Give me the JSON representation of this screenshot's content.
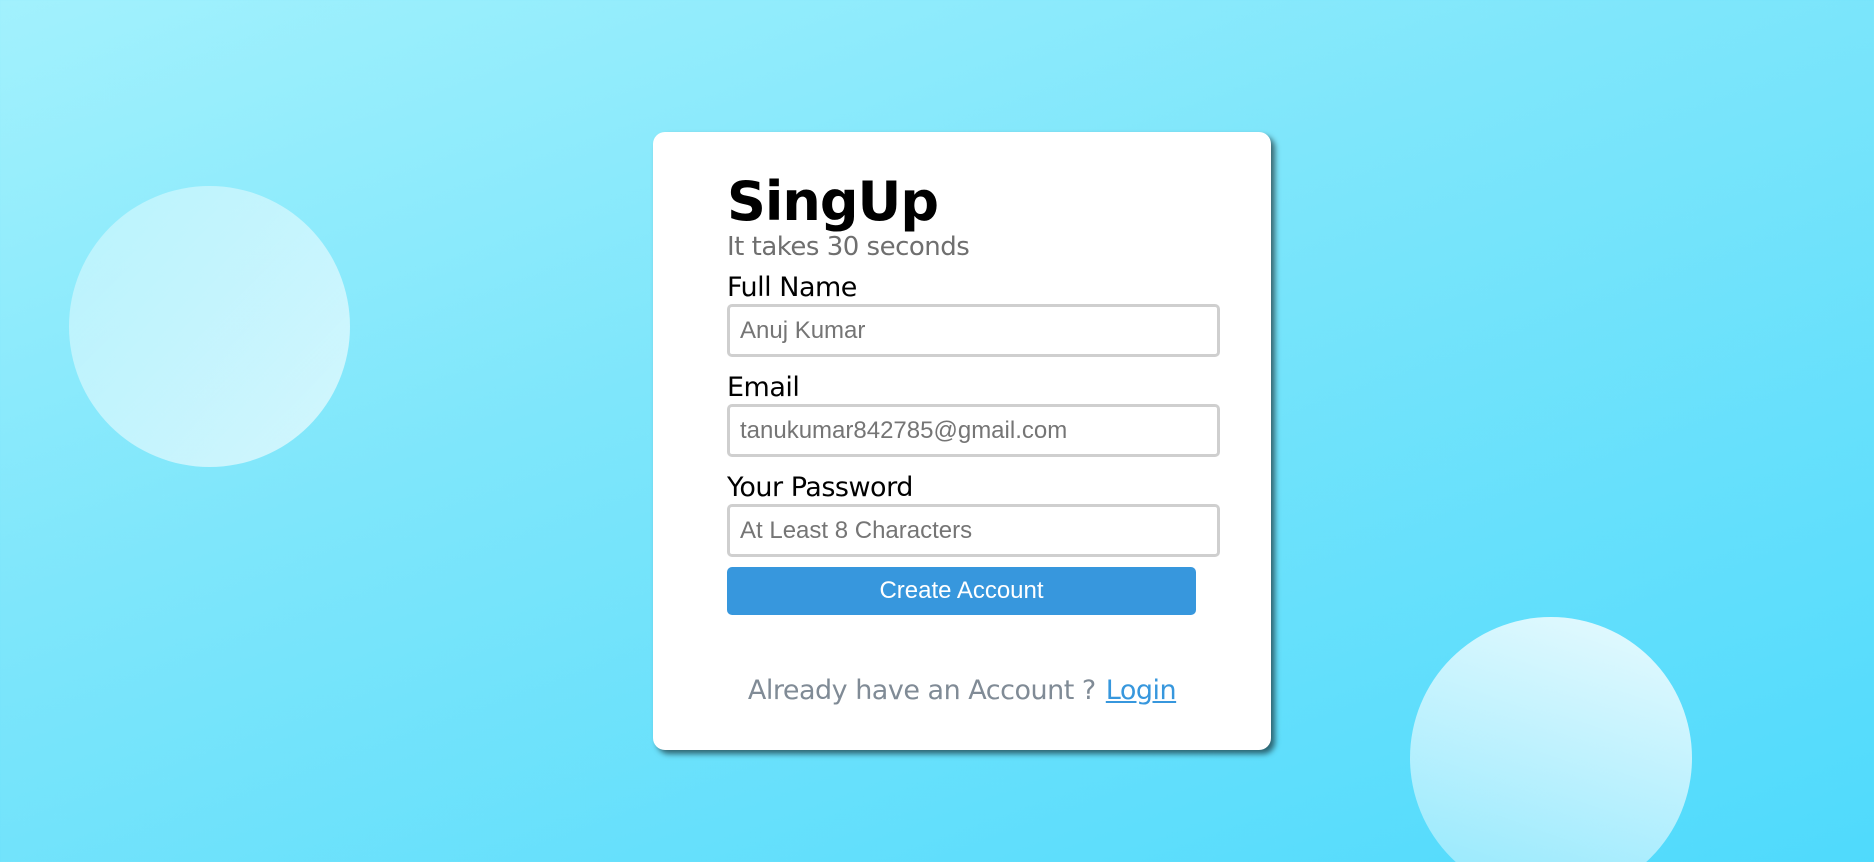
{
  "form": {
    "title": "SingUp",
    "subtitle": "It takes 30 seconds",
    "full_name": {
      "label": "Full Name",
      "placeholder": "Anuj Kumar",
      "value": ""
    },
    "email": {
      "label": "Email",
      "placeholder": "tanukumar842785@gmail.com",
      "value": ""
    },
    "password": {
      "label": "Your Password",
      "placeholder": "At Least 8 Characters",
      "value": ""
    },
    "submit_label": "Create Account",
    "footer_text": "Already have an Account ?",
    "login_label": "Login"
  },
  "colors": {
    "accent": "#3797dd",
    "background_start": "#a2f1fd",
    "background_end": "#4fdafc",
    "muted_text": "#808b96"
  }
}
